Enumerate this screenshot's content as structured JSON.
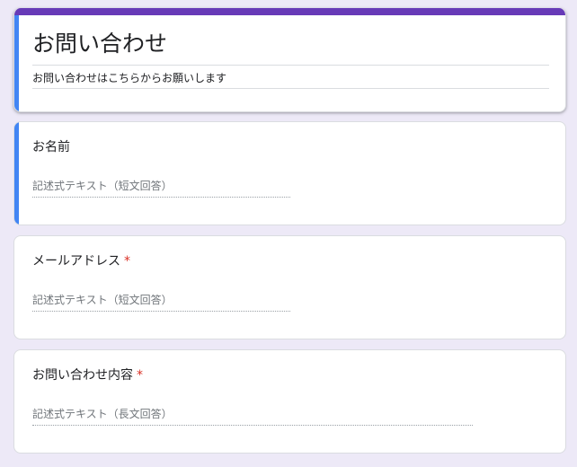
{
  "form": {
    "title": "お問い合わせ",
    "description": "お問い合わせはこちらからお願いします"
  },
  "questions": [
    {
      "title": "お名前",
      "required": "",
      "placeholder": "記述式テキスト（短文回答）"
    },
    {
      "title": "メールアドレス",
      "required": "*",
      "placeholder": "記述式テキスト（短文回答）"
    },
    {
      "title": "お問い合わせ内容",
      "required": "*",
      "placeholder": "記述式テキスト（長文回答）"
    }
  ],
  "colors": {
    "header_bar": "#673ab7",
    "accent": "#4285f4",
    "required": "#d93025",
    "background": "#ede9f7"
  }
}
